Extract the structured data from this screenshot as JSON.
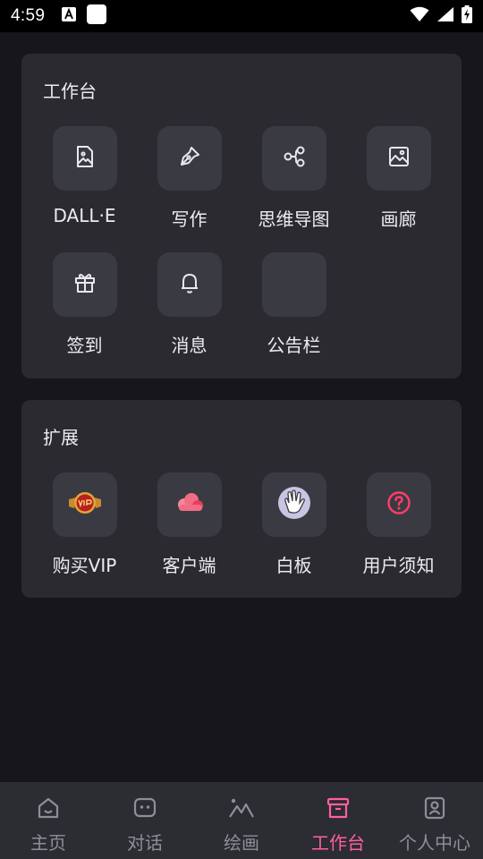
{
  "status_bar": {
    "time": "4:59"
  },
  "workbench": {
    "title": "工作台",
    "items": [
      {
        "label": "DALL·E",
        "icon": "image-icon"
      },
      {
        "label": "写作",
        "icon": "pen-icon"
      },
      {
        "label": "思维导图",
        "icon": "mindmap-icon"
      },
      {
        "label": "画廊",
        "icon": "gallery-icon"
      },
      {
        "label": "签到",
        "icon": "gift-icon"
      },
      {
        "label": "消息",
        "icon": "bell-icon"
      },
      {
        "label": "公告栏",
        "icon": ""
      }
    ]
  },
  "extensions": {
    "title": "扩展",
    "items": [
      {
        "label": "购买VIP",
        "icon": "vip-badge-icon"
      },
      {
        "label": "客户端",
        "icon": "cloud-icon"
      },
      {
        "label": "白板",
        "icon": "hand-wave-icon"
      },
      {
        "label": "用户须知",
        "icon": "question-circle-icon"
      }
    ]
  },
  "nav": {
    "items": [
      {
        "label": "主页",
        "icon": "home-icon"
      },
      {
        "label": "对话",
        "icon": "chat-icon"
      },
      {
        "label": "绘画",
        "icon": "mountain-icon"
      },
      {
        "label": "工作台",
        "icon": "archive-icon",
        "active": true
      },
      {
        "label": "个人中心",
        "icon": "user-icon"
      }
    ]
  },
  "colors": {
    "background": "#17161c",
    "card": "#2a2a30",
    "icon_box": "#3a3a42",
    "accent": "#ff5fa2",
    "nav_inactive": "#8e8e97"
  }
}
